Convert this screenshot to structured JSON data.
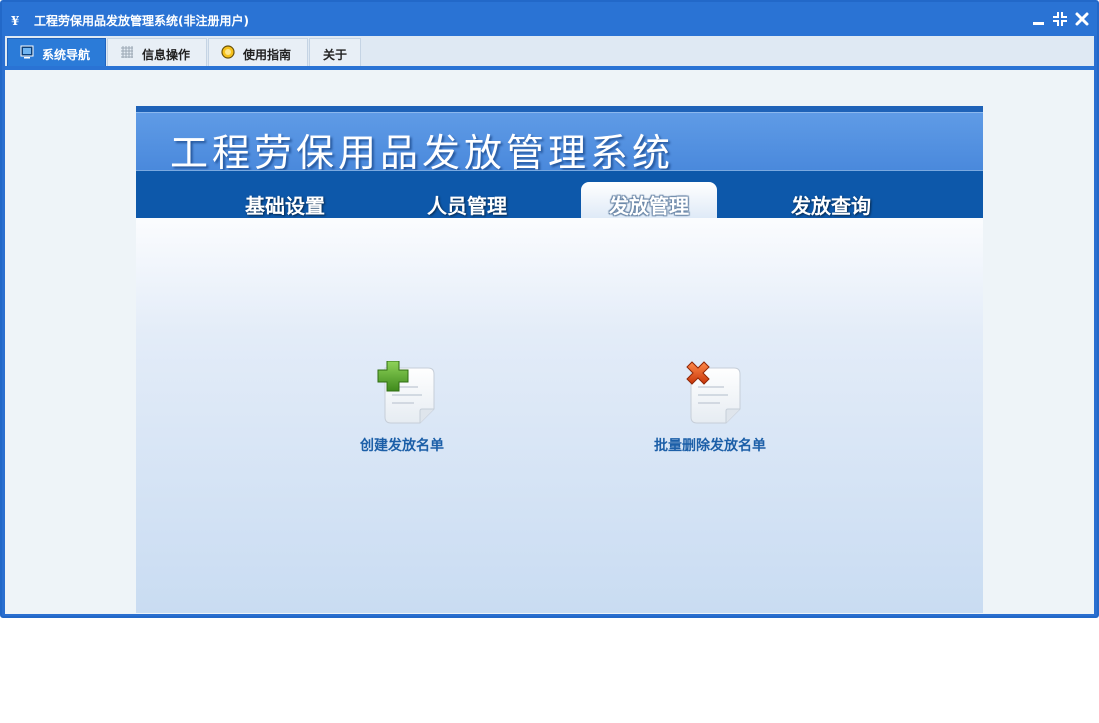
{
  "window": {
    "title": "工程劳保用品发放管理系统(非注册用户)",
    "icons": {
      "app": "app-logo-icon",
      "minimize": "minimize-icon",
      "restore": "restore-icon",
      "close": "close-icon"
    }
  },
  "menu": {
    "tabs": [
      {
        "label": "系统导航",
        "icon": "monitor-icon",
        "active": true
      },
      {
        "label": "信息操作",
        "icon": "grid-icon",
        "active": false
      },
      {
        "label": "使用指南",
        "icon": "help-circle-icon",
        "active": false
      },
      {
        "label": "关于",
        "active": false
      }
    ]
  },
  "banner": {
    "title": "工程劳保用品发放管理系统"
  },
  "nav": {
    "tabs": [
      {
        "label": "基础设置",
        "selected": false
      },
      {
        "label": "人员管理",
        "selected": false
      },
      {
        "label": "发放管理",
        "selected": true
      },
      {
        "label": "发放查询",
        "selected": false
      }
    ]
  },
  "actions": [
    {
      "label": "创建发放名单",
      "icon": "document-add-icon"
    },
    {
      "label": "批量删除发放名单",
      "icon": "document-delete-icon"
    }
  ],
  "colors": {
    "titlebar": "#2a73d4",
    "navbar": "#0d58aa",
    "accent": "#1c5fa8"
  }
}
